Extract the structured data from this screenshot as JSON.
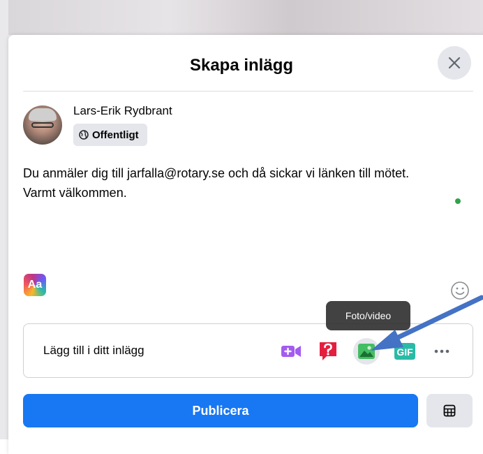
{
  "dialog": {
    "title": "Skapa inlägg",
    "close_icon": "close-icon"
  },
  "user": {
    "name": "Lars-Erik Rydbrant",
    "privacy_label": "Offentligt",
    "privacy_icon": "globe-icon"
  },
  "post": {
    "lines": [
      "Du anmäler dig till jarfalla@rotary.se och då sickar vi länken till mötet.",
      "Varmt välkommen."
    ]
  },
  "composer": {
    "text_style_label": "Aa",
    "emoji_icon": "smiley-icon"
  },
  "add_to_post": {
    "label": "Lägg till i ditt inlägg",
    "tools": [
      {
        "name": "live-video-icon",
        "color": "#a35bf0"
      },
      {
        "name": "question-icon",
        "color": "#e41e3f"
      },
      {
        "name": "photo-video-icon",
        "color": "#45bd62"
      },
      {
        "name": "gif-icon",
        "color": "#2abba7",
        "label": "GIF"
      },
      {
        "name": "more-icon",
        "color": "#050505"
      }
    ],
    "tooltip": "Foto/video"
  },
  "footer": {
    "publish_label": "Publicera",
    "schedule_icon": "calendar-grid-icon"
  },
  "colors": {
    "primary": "#1877f2",
    "annotation_arrow": "#4472c4"
  }
}
